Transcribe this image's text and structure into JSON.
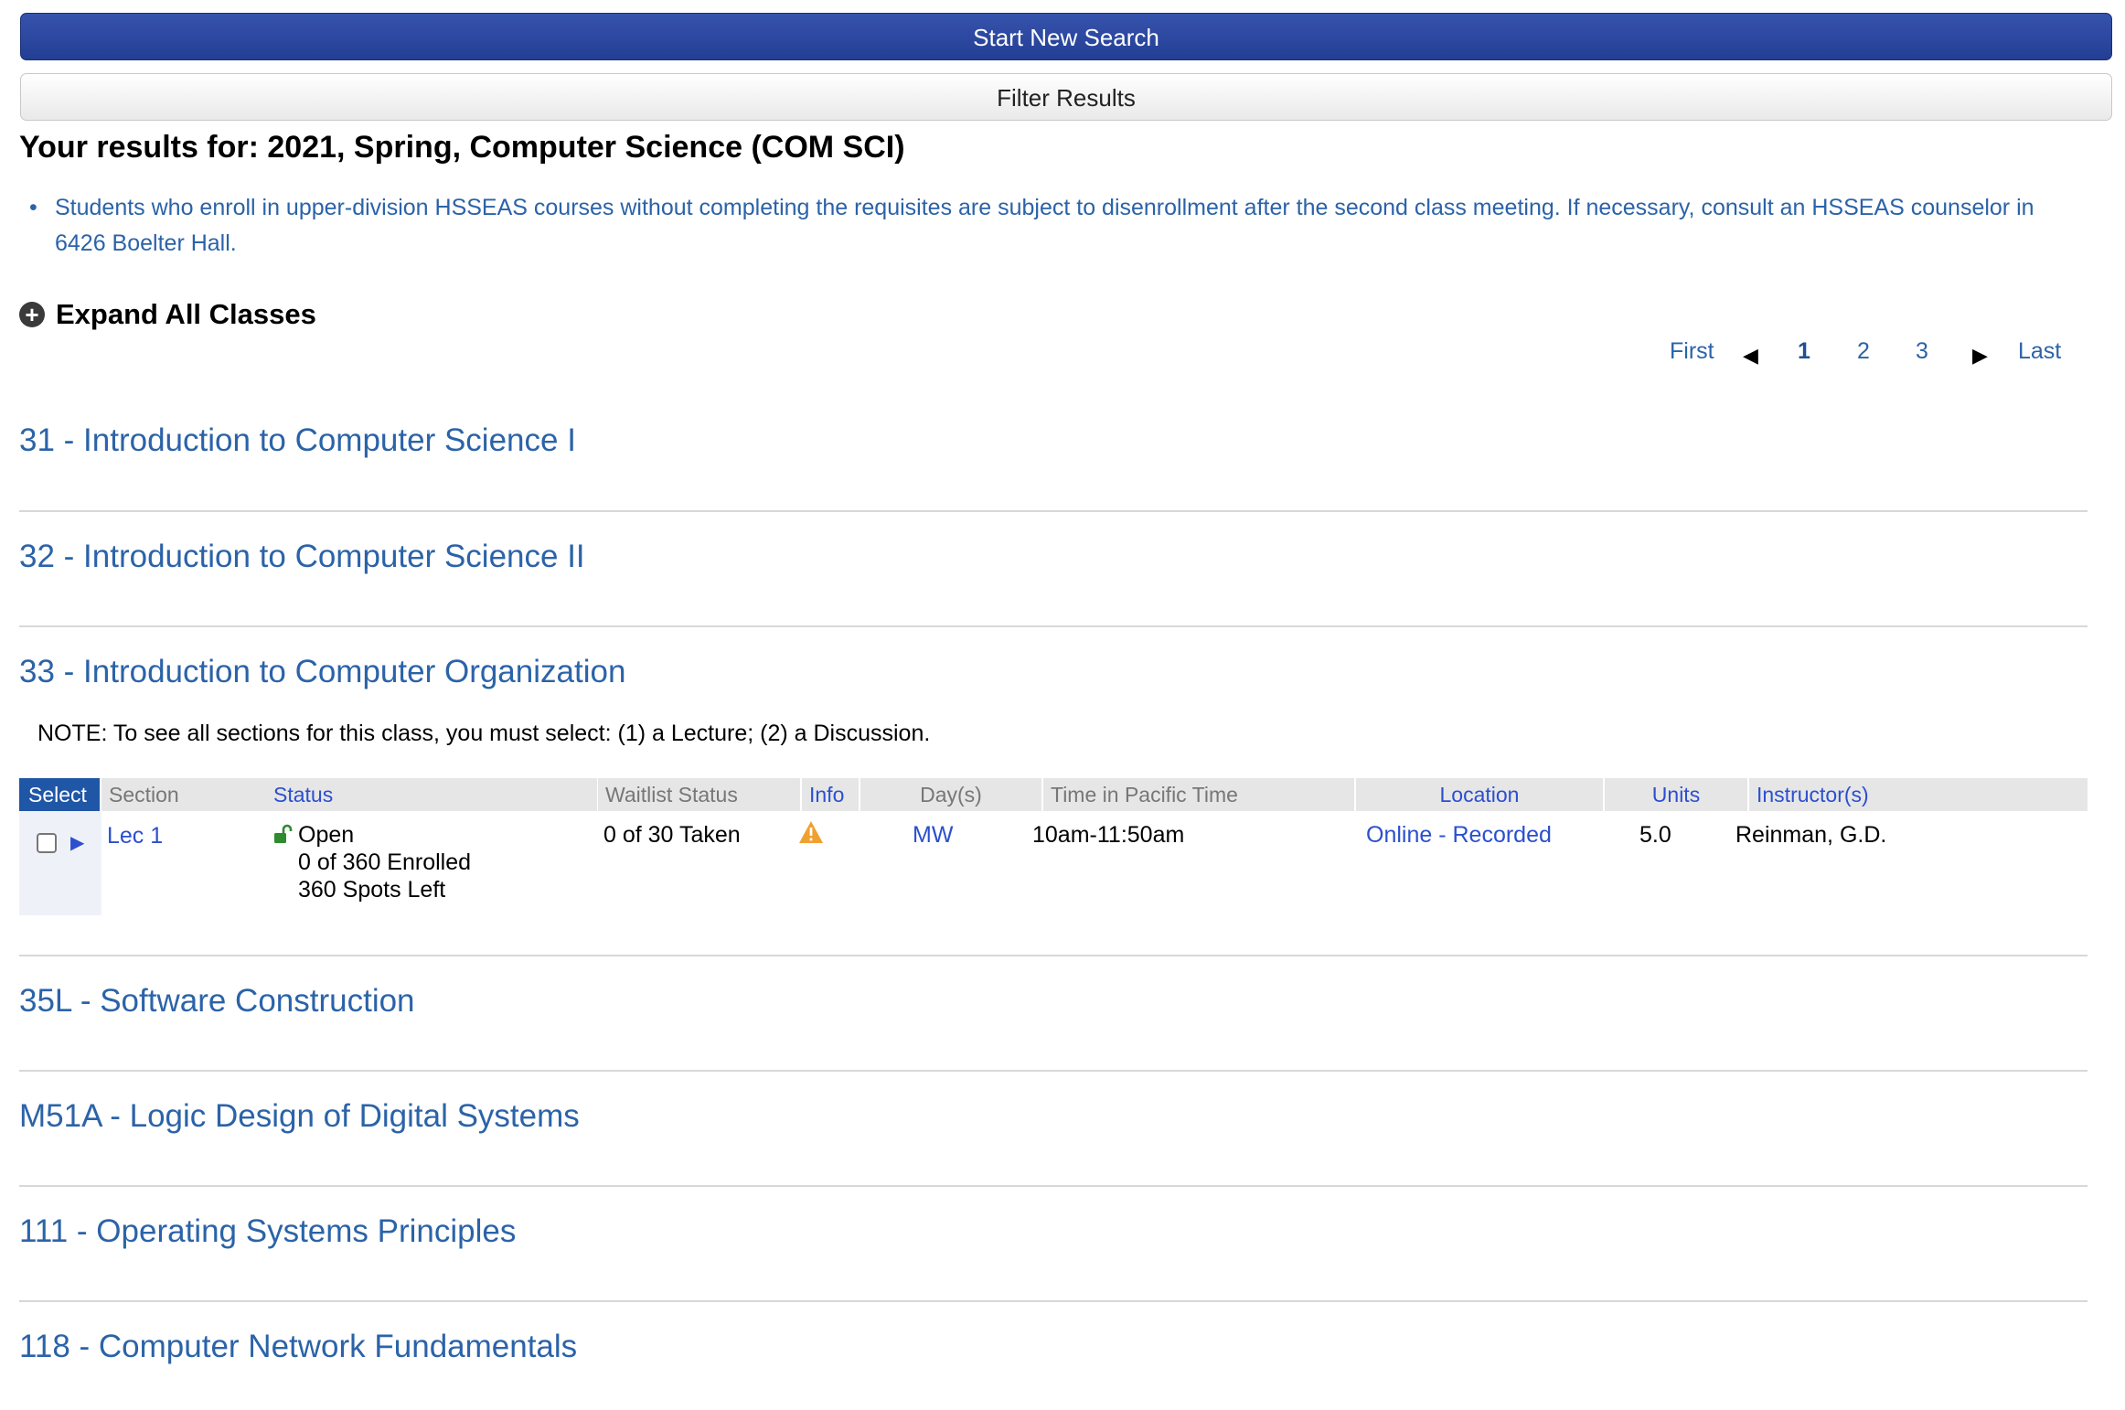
{
  "buttons": {
    "start_new_search": "Start New Search",
    "filter_results": "Filter Results"
  },
  "results_title": "Your results for: 2021, Spring, Computer Science (COM SCI)",
  "notice": {
    "bullet": "•",
    "text": "Students who enroll in upper-division HSSEAS courses without completing the requisites are subject to disenrollment after the second class meeting. If necessary, consult an HSSEAS counselor in 6426 Boelter Hall."
  },
  "expand_all": {
    "icon": "plus-circle-icon",
    "label": "Expand All Classes"
  },
  "pagination": {
    "first": "First",
    "pages": [
      "1",
      "2",
      "3"
    ],
    "current": "1",
    "last": "Last"
  },
  "courses": [
    "31 - Introduction to Computer Science I",
    "32 - Introduction to Computer Science II",
    "33 - Introduction to Computer Organization",
    "35L - Software Construction",
    "M51A - Logic Design of Digital Systems",
    "111 - Operating Systems Principles",
    "118 - Computer Network Fundamentals"
  ],
  "expanded_course_note": "NOTE: To see all sections for this class, you must select: (1) a Lecture; (2) a Discussion.",
  "table": {
    "headers": {
      "select": "Select",
      "section": "Section",
      "status": "Status",
      "waitlist": "Waitlist Status",
      "info": "Info",
      "days": "Day(s)",
      "time": "Time in Pacific Time",
      "location": "Location",
      "units": "Units",
      "instructors": "Instructor(s)"
    },
    "rows": [
      {
        "section": "Lec 1",
        "status": "Open",
        "enrolled": "0 of 360 Enrolled",
        "spots_left": "360 Spots Left",
        "waitlist": "0 of 30 Taken",
        "info_icon": "warning-icon",
        "days": "MW",
        "time": "10am-11:50am",
        "location": "Online - Recorded",
        "units": "5.0",
        "instructor": "Reinman, G.D."
      }
    ]
  },
  "colors": {
    "primary_button": "#233e94",
    "link_blue": "#2b63a8",
    "header_link": "#2b4fcf",
    "select_header": "#2056a6",
    "open_lock": "#2e8b2e",
    "warning": "#f0a030"
  }
}
